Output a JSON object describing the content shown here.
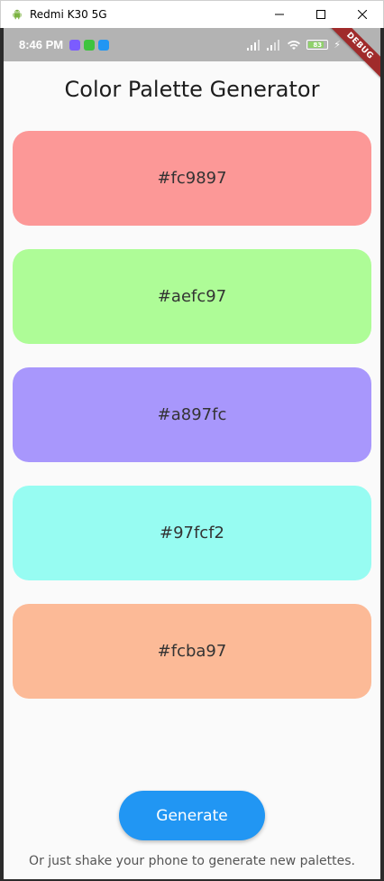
{
  "window": {
    "title": "Redmi K30 5G",
    "app_icon": "android-icon",
    "controls": [
      "minimize-icon",
      "maximize-icon",
      "close-icon"
    ]
  },
  "statusbar": {
    "time": "8:46 PM",
    "battery_level": "83",
    "notification_colors": [
      "#7b5cff",
      "#3ec43e",
      "#2196f3"
    ]
  },
  "debug_banner": "DEBUG",
  "app": {
    "title": "Color Palette Generator",
    "swatches": [
      {
        "label": "#fc9897",
        "color": "#fc9897"
      },
      {
        "label": "#aefc97",
        "color": "#aefc97"
      },
      {
        "label": "#a897fc",
        "color": "#a897fc"
      },
      {
        "label": "#97fcf2",
        "color": "#97fcf2"
      },
      {
        "label": "#fcba97",
        "color": "#fcba97"
      }
    ],
    "generate_label": "Generate",
    "hint": "Or just shake your phone to generate new palettes.",
    "accent": "#2196f3"
  }
}
